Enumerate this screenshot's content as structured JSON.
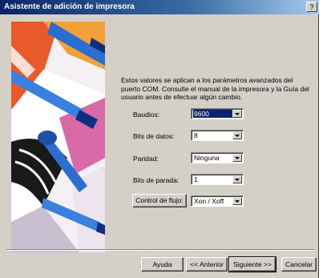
{
  "window": {
    "title": "Asistente de adición de impresora",
    "close_label": "?"
  },
  "intro_text": "Estos valores se aplican a los parámetros avanzados del puerto COM. Consulte el manual de la impresora y la Guía del usuario antes de efectuar algún cambio.",
  "fields": [
    {
      "label": "Baudios:",
      "value": "9600"
    },
    {
      "label": "Bits de datos:",
      "value": "8"
    },
    {
      "label": "Paridad:",
      "value": "Ninguna"
    },
    {
      "label": "Bits de parada:",
      "value": "1"
    }
  ],
  "flow": {
    "button_label": "Control de flujo:",
    "value": "Xon / Xoff"
  },
  "buttons": {
    "help": "Ayuda",
    "back": "<< Anterior",
    "next": "Siguiente >>",
    "cancel": "Cancelar"
  },
  "colors": {
    "title_start": "#0a246a",
    "title_end": "#a6caf0",
    "face": "#d4d0c8",
    "selection": "#0a246a"
  }
}
